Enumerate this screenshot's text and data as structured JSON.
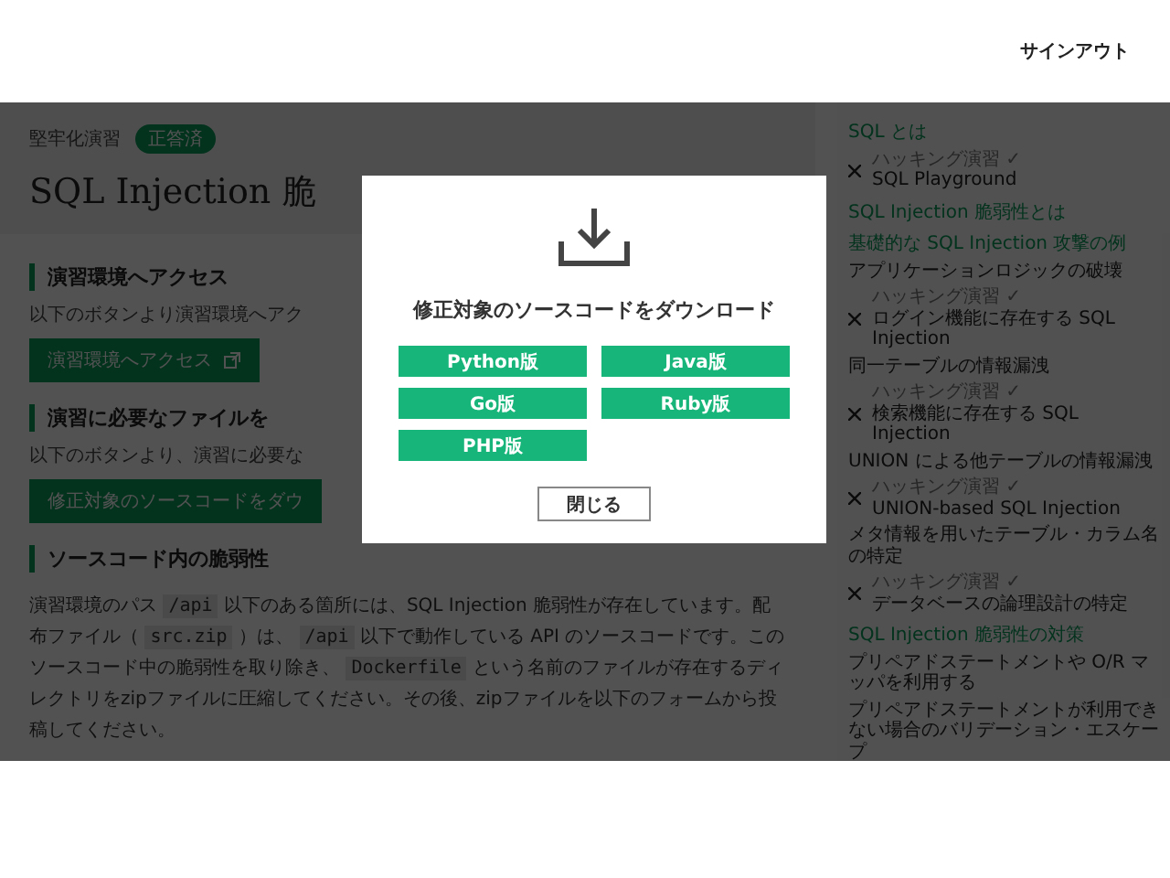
{
  "header": {
    "signout": "サインアウト"
  },
  "main": {
    "breadcrumb": "堅牢化演習",
    "status_tag": "正答済",
    "title": "SQL Injection 脆",
    "sections": [
      {
        "heading": "演習環境へアクセス",
        "text": "以下のボタンより演習環境へアク",
        "button": "演習環境へアクセス",
        "external": true
      },
      {
        "heading": "演習に必要なファイルを",
        "text": "以下のボタンより、演習に必要な",
        "button": "修正対象のソースコードをダウ",
        "external": false
      },
      {
        "heading": "ソースコード内の脆弱性",
        "paragraph": [
          {
            "text": "演習環境のパス ",
            "code": false
          },
          {
            "text": "/api",
            "code": true
          },
          {
            "text": " 以下のある箇所には、SQL Injection 脆弱性が存在しています。配布ファイル（ ",
            "code": false
          },
          {
            "text": "src.zip",
            "code": true
          },
          {
            "text": " ）は、 ",
            "code": false
          },
          {
            "text": "/api",
            "code": true
          },
          {
            "text": " 以下で動作している API のソースコードです。このソースコード中の脆弱性を取り除き、 ",
            "code": false
          },
          {
            "text": "Dockerfile",
            "code": true
          },
          {
            "text": " という名前のファイルが存在するディレクトリをzipファイルに圧縮してください。その後、zipファイルを以下のフォームから投稿してください。",
            "code": false
          }
        ]
      }
    ]
  },
  "sidebar": {
    "items": [
      {
        "kind": "heading",
        "text": "SQL とは"
      },
      {
        "kind": "exercise",
        "label": "ハッキング演習",
        "mark": "✓",
        "text": "SQL Playground"
      },
      {
        "kind": "heading",
        "text": "SQL Injection 脆弱性とは"
      },
      {
        "kind": "heading",
        "text": "基礎的な SQL Injection 攻撃の例"
      },
      {
        "kind": "link",
        "text": "アプリケーションロジックの破壊"
      },
      {
        "kind": "exercise",
        "label": "ハッキング演習",
        "mark": "✓",
        "text": "ログイン機能に存在する SQL Injection"
      },
      {
        "kind": "link",
        "text": "同一テーブルの情報漏洩"
      },
      {
        "kind": "exercise",
        "label": "ハッキング演習",
        "mark": "✓",
        "text": "検索機能に存在する SQL Injection"
      },
      {
        "kind": "link",
        "text": "UNION による他テーブルの情報漏洩"
      },
      {
        "kind": "exercise",
        "label": "ハッキング演習",
        "mark": "✓",
        "text": "UNION-based SQL Injection"
      },
      {
        "kind": "link",
        "text": "メタ情報を用いたテーブル・カラム名の特定"
      },
      {
        "kind": "exercise",
        "label": "ハッキング演習",
        "mark": "✓",
        "text": "データベースの論理設計の特定"
      },
      {
        "kind": "heading",
        "text": "SQL Injection 脆弱性の対策"
      },
      {
        "kind": "link",
        "text": "プリペアドステートメントや O/R マッパを利用する"
      },
      {
        "kind": "link",
        "text": "プリペアドステートメントが利用できない場合のバリデーション・エスケープ"
      }
    ]
  },
  "modal": {
    "title": "修正対象のソースコードをダウンロード",
    "options": [
      "Python版",
      "Java版",
      "Go版",
      "Ruby版",
      "PHP版"
    ],
    "close": "閉じる"
  }
}
